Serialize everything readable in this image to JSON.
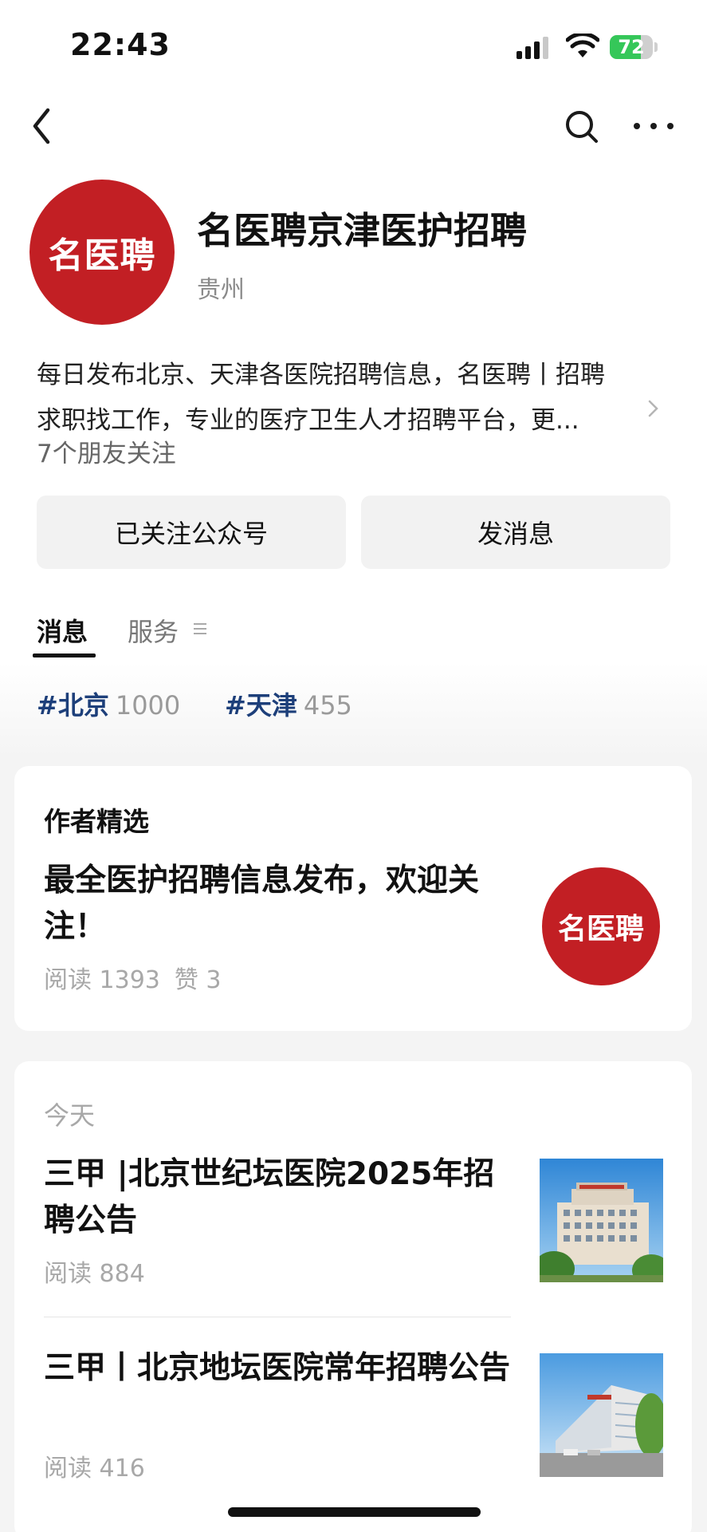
{
  "status_bar": {
    "time": "22:43",
    "battery": "72",
    "battery_level": 0.72
  },
  "nav": {
    "back_icon": "chevron-left-icon",
    "search_icon": "search-icon",
    "more_icon": "more-dots-icon"
  },
  "profile": {
    "avatar_text": "名医聘",
    "name": "名医聘京津医护招聘",
    "location": "贵州",
    "description_line1": "每日发布北京、天津各医院招聘信息，名医聘丨招聘",
    "description_line2": "求职找工作，专业的医疗卫生人才招聘平台，更...",
    "friends_following": "7个朋友关注"
  },
  "actions": {
    "follow_label": "已关注公众号",
    "message_label": "发消息"
  },
  "tabs": [
    {
      "label": "消息",
      "active": true
    },
    {
      "label": "服务",
      "active": false
    }
  ],
  "tags": [
    {
      "name": "#北京",
      "count": "1000"
    },
    {
      "name": "#天津",
      "count": "455"
    }
  ],
  "featured": {
    "section_title": "作者精选",
    "title": "最全医护招聘信息发布，欢迎关注！",
    "reads": "阅读 1393",
    "likes": "赞 3",
    "thumb_text": "名医聘"
  },
  "feed": {
    "date_label": "今天",
    "articles": [
      {
        "title": "三甲 |北京世纪坛医院2025年招聘公告",
        "reads": "阅读 884",
        "thumb": "hospital-building-photo"
      },
      {
        "title": "三甲丨北京地坛医院常年招聘公告",
        "reads": "阅读 416",
        "thumb": "hospital-building-photo"
      }
    ]
  },
  "colors": {
    "brand_red": "#c21f24",
    "tag_blue": "#1d3f7a",
    "battery_green": "#35c759"
  }
}
